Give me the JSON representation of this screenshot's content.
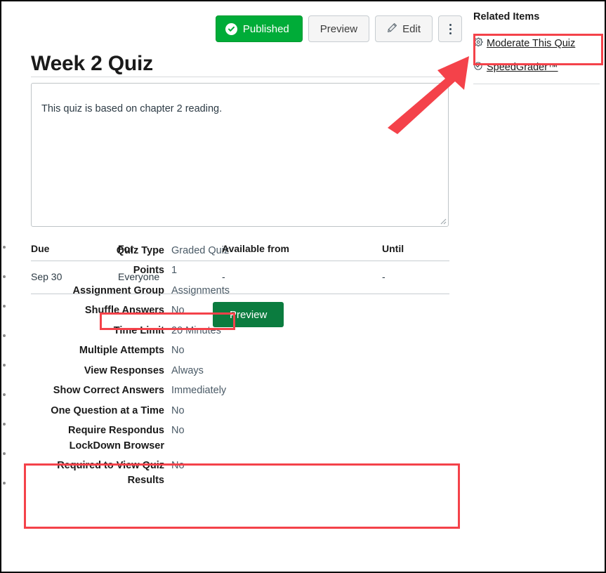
{
  "toolbar": {
    "published_label": "Published",
    "published_icon": "check-circle-icon",
    "published_color": "#00ac38",
    "preview_label": "Preview",
    "edit_label": "Edit",
    "edit_icon": "pencil-icon",
    "kebab_icon": "more-vertical-icon"
  },
  "quiz": {
    "title": "Week 2 Quiz",
    "description": "This quiz is based on chapter 2 reading."
  },
  "details": [
    {
      "label": "Quiz Type",
      "value": "Graded Quiz"
    },
    {
      "label": "Points",
      "value": "1"
    },
    {
      "label": "Assignment Group",
      "value": "Assignments"
    },
    {
      "label": "Shuffle Answers",
      "value": "No"
    },
    {
      "label": "Time Limit",
      "value": "20 Minutes"
    },
    {
      "label": "Multiple Attempts",
      "value": "No"
    },
    {
      "label": "View Responses",
      "value": "Always"
    },
    {
      "label": "Show Correct Answers",
      "value": "Immediately"
    },
    {
      "label": "One Question at a Time",
      "value": "No"
    },
    {
      "label": "Require Respondus LockDown Browser",
      "value": "No"
    },
    {
      "label": "Required to View Quiz Results",
      "value": "No"
    }
  ],
  "due_table": {
    "headers": [
      "Due",
      "For",
      "Available from",
      "Until"
    ],
    "rows": [
      {
        "due": "Sep 30",
        "for": "Everyone",
        "available_from": "-",
        "until": "-"
      }
    ]
  },
  "bottom": {
    "preview_label": "Preview",
    "preview_color": "#0b7c3f"
  },
  "sidebar": {
    "heading": "Related Items",
    "items": [
      {
        "label": "Moderate This Quiz",
        "icon": "gear-icon"
      },
      {
        "label": "SpeedGrader™",
        "icon": "speedgrader-icon"
      }
    ]
  },
  "annotations": {
    "highlight_color": "#f4424a",
    "arrow_color": "#f4424a",
    "boxes": [
      "moderate-this-quiz",
      "time-limit-row",
      "due-dates-table"
    ],
    "arrow_points_to": "moderate-this-quiz"
  }
}
